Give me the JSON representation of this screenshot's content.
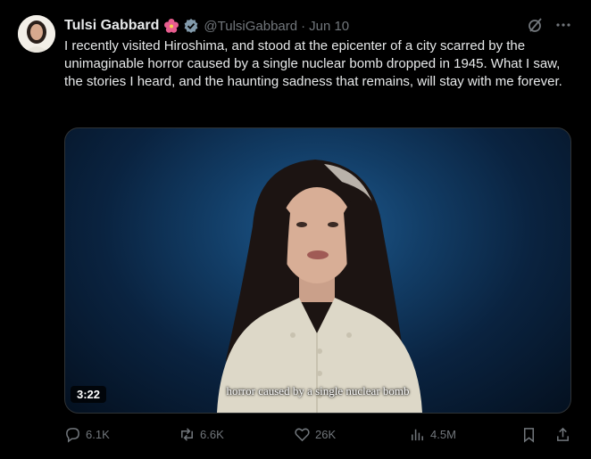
{
  "author": {
    "name": "Tulsi Gabbard",
    "handle": "@TulsiGabbard",
    "separator": "·",
    "date": "Jun 10"
  },
  "post": {
    "text": "I recently visited Hiroshima, and stood at the epicenter of a city scarred by the unimaginable horror caused by a single nuclear bomb dropped in 1945. What I saw, the stories I heard, and the haunting sadness that remains, will stay with me forever."
  },
  "video": {
    "duration": "3:22",
    "subtitle": "horror caused by a single nuclear bomb"
  },
  "actions": {
    "replies": "6.1K",
    "reposts": "6.6K",
    "likes": "26K",
    "views": "4.5M"
  },
  "colors": {
    "background": "#000000",
    "text": "#e7e9ea",
    "muted": "#71767b",
    "verified": "#829aab"
  },
  "icons": [
    "flower-emoji-icon",
    "verified-badge-icon",
    "grok-icon",
    "more-icon",
    "reply-icon",
    "repost-icon",
    "like-icon",
    "views-icon",
    "bookmark-icon",
    "share-icon"
  ]
}
